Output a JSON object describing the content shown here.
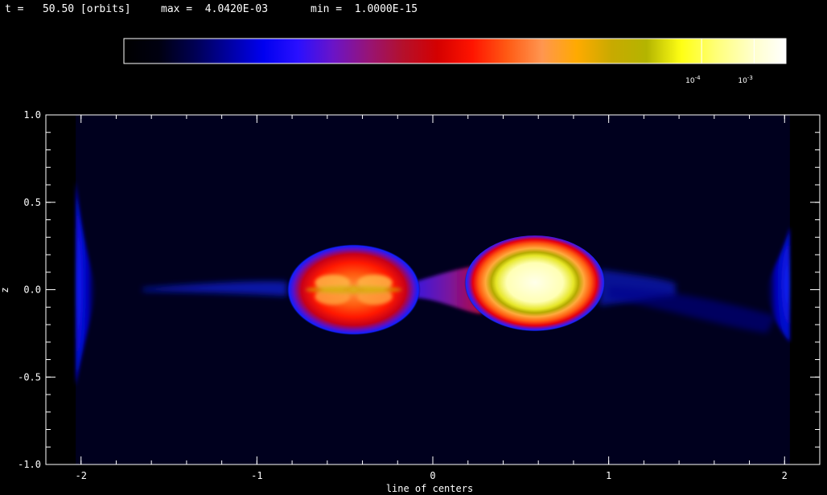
{
  "header": {
    "time_text": "t =   50.50 [orbits]",
    "max_text": "max =  4.0420E-03",
    "min_text": "min =  1.0000E-15"
  },
  "colorbar": {
    "ticks": [
      {
        "value": 0.0001,
        "base": "10",
        "exp": "-4"
      },
      {
        "value": 0.001,
        "base": "10",
        "exp": "-3"
      }
    ],
    "colors": [
      "#000000",
      "#000010",
      "#000050",
      "#0000a0",
      "#0000f0",
      "#2a10ff",
      "#6a14c8",
      "#961478",
      "#b4102c",
      "#d40000",
      "#ff1400",
      "#ff5a14",
      "#ff9650",
      "#ffaa00",
      "#c8aa00",
      "#b4b400",
      "#ffff14",
      "#ffff78",
      "#ffffc8",
      "#ffffff"
    ]
  },
  "chart_data": {
    "type": "heatmap",
    "title": "",
    "xlabel": "line of centers",
    "ylabel": "z",
    "xlim": [
      -2.2,
      2.2
    ],
    "ylim": [
      -1.0,
      1.0
    ],
    "x_ticks": [
      {
        "value": -2,
        "label": "-2"
      },
      {
        "value": -1,
        "label": "-1"
      },
      {
        "value": 0,
        "label": "0"
      },
      {
        "value": 1,
        "label": "1"
      },
      {
        "value": 2,
        "label": "2"
      }
    ],
    "y_ticks": [
      {
        "value": 1.0,
        "label": "1.0"
      },
      {
        "value": 0.5,
        "label": "0.5"
      },
      {
        "value": 0.0,
        "label": "0.0"
      },
      {
        "value": -0.5,
        "label": "-0.5"
      },
      {
        "value": -1.0,
        "label": "-1.0"
      }
    ],
    "domain_x": [
      -2.03,
      2.03
    ],
    "color_scale": "log",
    "data_max": 0.004042,
    "data_min": 1e-15,
    "features": [
      {
        "name": "left-star",
        "center": [
          -0.45,
          0.0
        ],
        "radius_x": 0.38,
        "radius_y": 0.26,
        "peak_color": "#ff9650"
      },
      {
        "name": "right-star",
        "center": [
          0.58,
          0.03
        ],
        "radius_x": 0.4,
        "radius_y": 0.28,
        "peak_color": "#ffffe0"
      }
    ]
  }
}
